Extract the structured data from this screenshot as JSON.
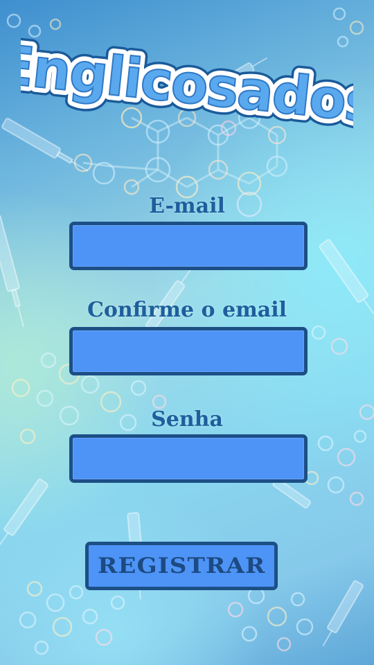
{
  "app": {
    "title": "Englicosados"
  },
  "form": {
    "email_label": "E-mail",
    "email_value": "",
    "confirm_label": "Confirme o email",
    "confirm_value": "",
    "password_label": "Senha",
    "password_value": ""
  },
  "actions": {
    "register_label": "REGISTRAR"
  },
  "colors": {
    "field_fill": "#4e94f7",
    "field_border": "#1c4f86",
    "label_text": "#1d5f9c",
    "logo_fill": "#5aa9ee",
    "logo_outline": "#ffffff"
  },
  "decorations": [
    "molecule-icon",
    "syringe-icon",
    "bubble-icon"
  ]
}
